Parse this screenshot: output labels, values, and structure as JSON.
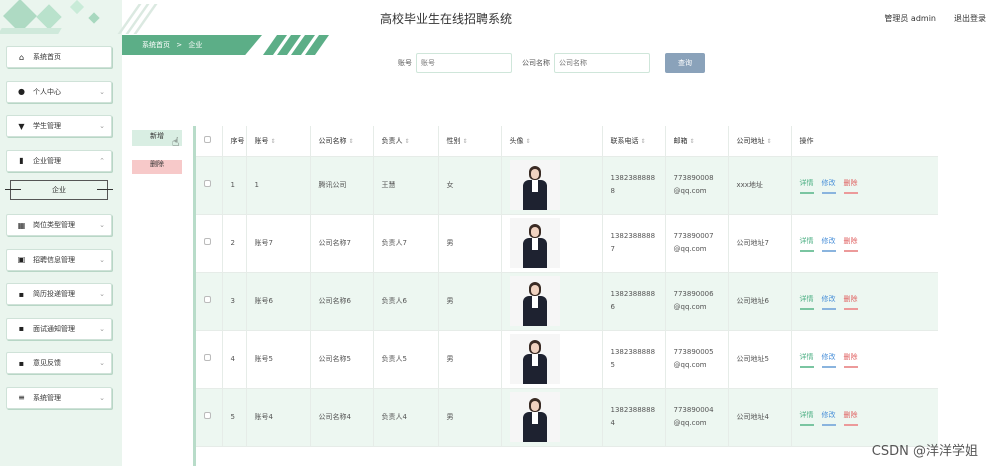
{
  "header": {
    "title": "高校毕业生在线招聘系统",
    "user": "管理员 admin",
    "logout": "退出登录"
  },
  "breadcrumb": {
    "home": "系统首页",
    "sep": ">",
    "current": "企业"
  },
  "sidebar": {
    "items": [
      {
        "label": "系统首页",
        "icon": "home-icon",
        "glyph": "⌂"
      },
      {
        "label": "个人中心",
        "icon": "person-icon",
        "glyph": "●"
      },
      {
        "label": "学生管理",
        "icon": "student-icon",
        "glyph": "▼"
      },
      {
        "label": "企业管理",
        "icon": "chart-icon",
        "glyph": "▮"
      },
      {
        "label": "企业"
      },
      {
        "label": "岗位类型管理",
        "icon": "building-icon",
        "glyph": "▦"
      },
      {
        "label": "招聘信息管理",
        "icon": "calendar-icon",
        "glyph": "▣"
      },
      {
        "label": "简历投递管理",
        "icon": "grid-icon",
        "glyph": "▪"
      },
      {
        "label": "面试通知管理",
        "icon": "grid-icon",
        "glyph": "▪"
      },
      {
        "label": "意见反馈",
        "icon": "grid-icon",
        "glyph": "▪"
      },
      {
        "label": "系统管理",
        "icon": "sliders-icon",
        "glyph": "≡"
      }
    ]
  },
  "search": {
    "account_label": "账号",
    "account_placeholder": "账号",
    "company_label": "公司名称",
    "company_placeholder": "公司名称",
    "button": "查询"
  },
  "actions": {
    "add": "新增",
    "delete": "删除"
  },
  "table": {
    "headers": [
      "序号",
      "账号",
      "公司名称",
      "负责人",
      "性别",
      "头像",
      "联系电话",
      "邮箱",
      "公司地址",
      "操作"
    ],
    "rows": [
      {
        "no": "1",
        "account": "1",
        "company": "腾讯公司",
        "manager": "王慧",
        "gender": "女",
        "phone1": "1382388888",
        "phone2": "8",
        "email1": "773890008",
        "email2": "@qq.com",
        "address": "xxx地址"
      },
      {
        "no": "2",
        "account": "账号7",
        "company": "公司名称7",
        "manager": "负责人7",
        "gender": "男",
        "phone1": "1382388888",
        "phone2": "7",
        "email1": "773890007",
        "email2": "@qq.com",
        "address": "公司地址7"
      },
      {
        "no": "3",
        "account": "账号6",
        "company": "公司名称6",
        "manager": "负责人6",
        "gender": "男",
        "phone1": "1382388888",
        "phone2": "6",
        "email1": "773890006",
        "email2": "@qq.com",
        "address": "公司地址6"
      },
      {
        "no": "4",
        "account": "账号5",
        "company": "公司名称5",
        "manager": "负责人5",
        "gender": "男",
        "phone1": "1382388888",
        "phone2": "5",
        "email1": "773890005",
        "email2": "@qq.com",
        "address": "公司地址5"
      },
      {
        "no": "5",
        "account": "账号4",
        "company": "公司名称4",
        "manager": "负责人4",
        "gender": "男",
        "phone1": "1382388888",
        "phone2": "4",
        "email1": "773890004",
        "email2": "@qq.com",
        "address": "公司地址4"
      }
    ],
    "ops": {
      "detail": "详情",
      "edit": "修改",
      "delete": "删除"
    }
  },
  "watermark": "CSDN @洋洋学姐",
  "colors": {
    "accent": "#5cae87",
    "row_alt": "#edf7f1",
    "search_btn": "#8aa2ba"
  }
}
